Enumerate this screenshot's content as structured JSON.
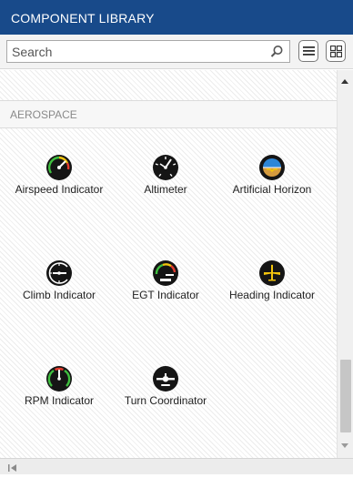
{
  "panel": {
    "title": "COMPONENT LIBRARY"
  },
  "search": {
    "placeholder": "Search",
    "value": ""
  },
  "view_toggle": {
    "list_icon": "list-view-icon",
    "grid_icon": "grid-view-icon"
  },
  "category": {
    "name": "AEROSPACE"
  },
  "components": [
    {
      "label": "Airspeed Indicator",
      "icon": "airspeed-indicator-icon"
    },
    {
      "label": "Altimeter",
      "icon": "altimeter-icon"
    },
    {
      "label": "Artificial Horizon",
      "icon": "artificial-horizon-icon"
    },
    {
      "label": "Climb Indicator",
      "icon": "climb-indicator-icon"
    },
    {
      "label": "EGT Indicator",
      "icon": "egt-indicator-icon"
    },
    {
      "label": "Heading Indicator",
      "icon": "heading-indicator-icon"
    },
    {
      "label": "RPM Indicator",
      "icon": "rpm-indicator-icon"
    },
    {
      "label": "Turn Coordinator",
      "icon": "turn-coordinator-icon"
    }
  ],
  "colors": {
    "header_bg": "#184a8a",
    "gauge_face": "#151515",
    "gauge_green": "#3fbf3f",
    "gauge_red": "#e23b2e",
    "gauge_yellow": "#f2c40d",
    "horizon_sky": "#2d86d6",
    "horizon_ground": "#d49a3e"
  }
}
